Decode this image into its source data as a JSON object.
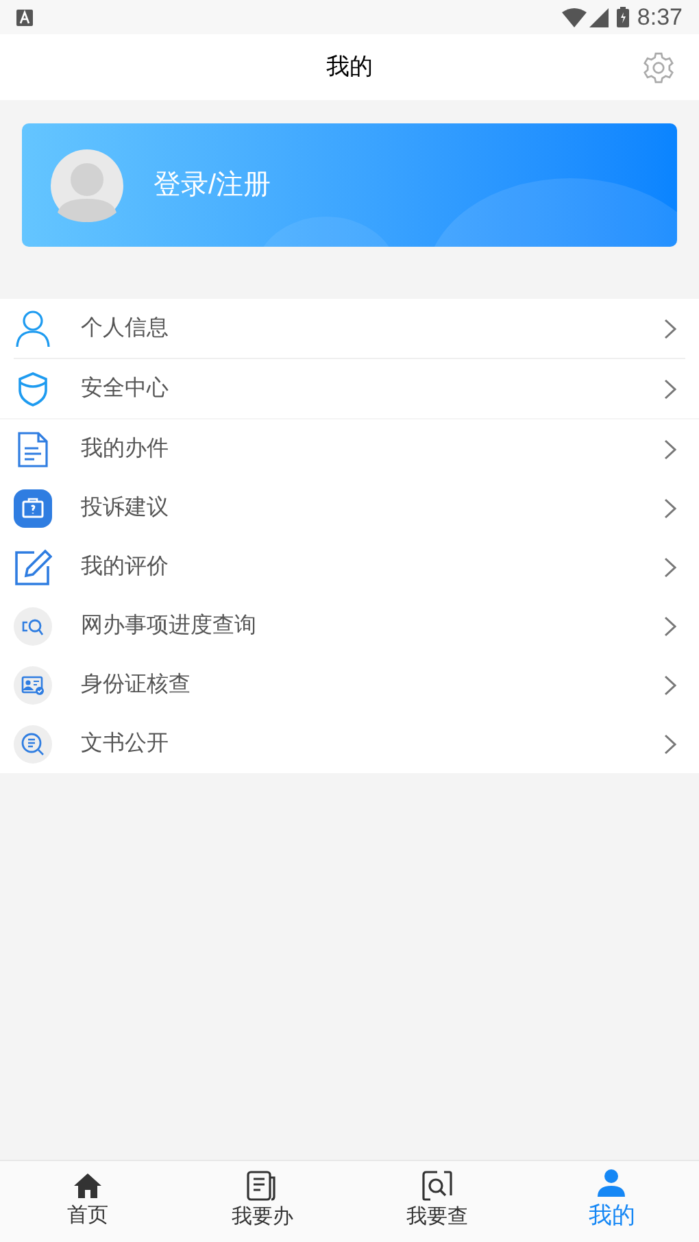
{
  "status_bar": {
    "time": "8:37"
  },
  "header": {
    "title": "我的"
  },
  "profile": {
    "login_label": "登录/注册"
  },
  "menu_groups": [
    {
      "items": [
        {
          "label": "个人信息"
        },
        {
          "label": "安全中心"
        }
      ]
    },
    {
      "items": [
        {
          "label": "我的办件"
        },
        {
          "label": "投诉建议"
        },
        {
          "label": "我的评价"
        },
        {
          "label": "网办事项进度查询"
        },
        {
          "label": "身份证核查"
        },
        {
          "label": "文书公开"
        }
      ]
    }
  ],
  "tabs": [
    {
      "label": "首页",
      "selected": false
    },
    {
      "label": "我要办",
      "selected": false
    },
    {
      "label": "我要查",
      "selected": false
    },
    {
      "label": "我的",
      "selected": true
    }
  ]
}
